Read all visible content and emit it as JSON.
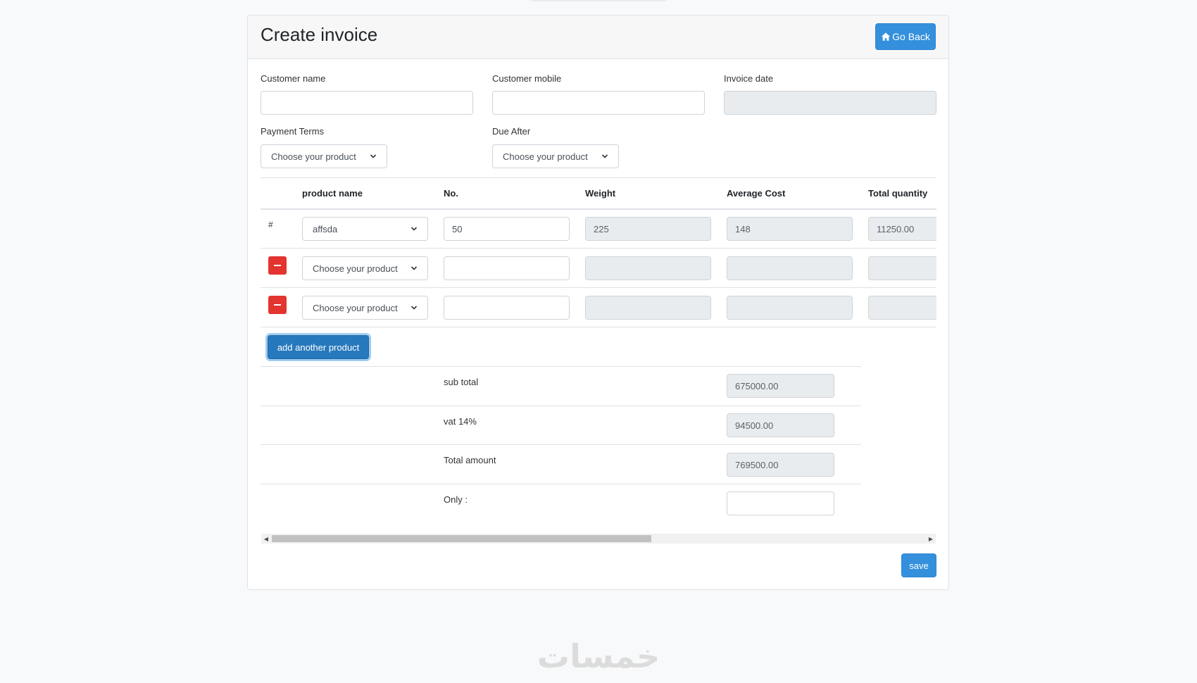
{
  "title": "Create invoice",
  "go_back_label": "Go Back",
  "fields": {
    "customer_name": {
      "label": "Customer name",
      "value": ""
    },
    "customer_mobile": {
      "label": "Customer mobile",
      "value": ""
    },
    "invoice_date": {
      "label": "Invoice date",
      "value": ""
    },
    "payment_terms": {
      "label": "Payment Terms",
      "selected": "Choose your product"
    },
    "due_after": {
      "label": "Due After",
      "selected": "Choose your product"
    }
  },
  "table": {
    "headers": [
      "product name",
      "No.",
      "Weight",
      "Average Cost",
      "Total quantity"
    ],
    "rows": [
      {
        "marker": "#",
        "product": "affsda",
        "no": "50",
        "weight": "225",
        "avg_cost": "148",
        "total_qty": "11250.00"
      },
      {
        "marker": "",
        "product": "Choose your product",
        "no": "",
        "weight": "",
        "avg_cost": "",
        "total_qty": ""
      },
      {
        "marker": "",
        "product": "Choose your product",
        "no": "",
        "weight": "",
        "avg_cost": "",
        "total_qty": ""
      }
    ]
  },
  "add_product_label": "add another product",
  "totals": {
    "sub_total": {
      "label": "sub total",
      "value": "675000.00"
    },
    "vat": {
      "label": "vat 14%",
      "value": "94500.00"
    },
    "total_amount": {
      "label": "Total amount",
      "value": "769500.00"
    },
    "only": {
      "label": "Only :",
      "value": ""
    }
  },
  "save_label": "save",
  "colors": {
    "primary": "#3490dc",
    "danger": "#e3342f",
    "readonly": "#e9ecef"
  },
  "watermark_text": "خمسات"
}
